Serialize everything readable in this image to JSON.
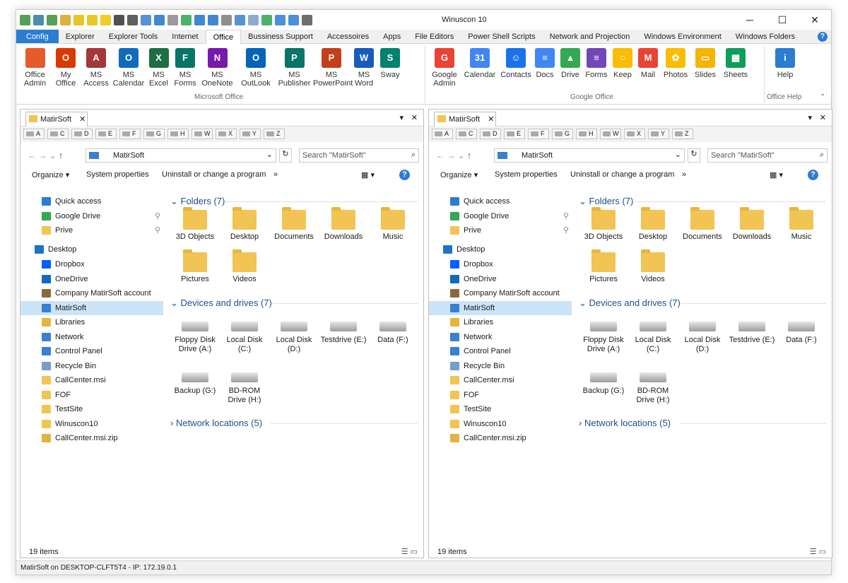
{
  "window": {
    "title": "Winuscon 10"
  },
  "tabs": [
    "Config",
    "Explorer",
    "Explorer Tools",
    "Internet",
    "Office",
    "Bussiness Support",
    "Accessoires",
    "Apps",
    "File Editors",
    "Power Shell Scripts",
    "Network and Projection",
    "Windows Environment",
    "Windows Folders"
  ],
  "help_glyph": "?",
  "ribbon": {
    "ms_items": [
      {
        "label": "Office Admin",
        "color": "#e65b2b",
        "glyph": ""
      },
      {
        "label": "My Office",
        "color": "#d83b01",
        "glyph": "O"
      },
      {
        "label": "MS Access",
        "color": "#a4373a",
        "glyph": "A"
      },
      {
        "label": "MS Calendar",
        "color": "#0f6cbd",
        "glyph": "O"
      },
      {
        "label": "MS Excel",
        "color": "#1d6f42",
        "glyph": "X"
      },
      {
        "label": "MS Forms",
        "color": "#077568",
        "glyph": "F"
      },
      {
        "label": "MS OneNote",
        "color": "#7719aa",
        "glyph": "N"
      },
      {
        "label": "MS OutLook",
        "color": "#0364b8",
        "glyph": "O"
      },
      {
        "label": "MS Publisher",
        "color": "#077568",
        "glyph": "P"
      },
      {
        "label": "MS PowerPoint",
        "color": "#c43e1c",
        "glyph": "P"
      },
      {
        "label": "MS Word",
        "color": "#185abd",
        "glyph": "W"
      },
      {
        "label": "Sway",
        "color": "#008272",
        "glyph": "S"
      }
    ],
    "google_items": [
      {
        "label": "Google Admin",
        "color": "#ea4335",
        "glyph": "G"
      },
      {
        "label": "Calendar",
        "color": "#4285f4",
        "glyph": "31"
      },
      {
        "label": "Contacts",
        "color": "#1a73e8",
        "glyph": "☺"
      },
      {
        "label": "Docs",
        "color": "#4285f4",
        "glyph": "≡"
      },
      {
        "label": "Drive",
        "color": "#34a853",
        "glyph": "▲"
      },
      {
        "label": "Forms",
        "color": "#7248b9",
        "glyph": "≡"
      },
      {
        "label": "Keep",
        "color": "#fbbc04",
        "glyph": "○"
      },
      {
        "label": "Mail",
        "color": "#ea4335",
        "glyph": "M"
      },
      {
        "label": "Photos",
        "color": "#fbbc04",
        "glyph": "✿"
      },
      {
        "label": "Slides",
        "color": "#f4b400",
        "glyph": "▭"
      },
      {
        "label": "Sheets",
        "color": "#0f9d58",
        "glyph": "▦"
      }
    ],
    "help_item": {
      "label": "Help",
      "color": "#2b7cd3",
      "glyph": "i"
    },
    "groups": [
      "Microsoft Office",
      "Google Office",
      "Office Help"
    ]
  },
  "pane": {
    "tab_label": "MatirSoft",
    "drives": [
      "A",
      "C",
      "D",
      "E",
      "F",
      "G",
      "H",
      "W",
      "X",
      "Y",
      "Z"
    ],
    "breadcrumb": "MatirSoft",
    "search_placeholder": "Search \"MatirSoft\"",
    "toolbar": [
      "Organize ▾",
      "System properties",
      "Uninstall or change a program",
      "»"
    ],
    "tree": [
      {
        "label": "Quick access",
        "color": "#2b7cd3"
      },
      {
        "label": "Google Drive",
        "color": "#34a853"
      },
      {
        "label": "Prive",
        "color": "#f1c453"
      },
      {
        "label": "Desktop",
        "color": "#1e73c8"
      },
      {
        "label": "Dropbox",
        "color": "#0061fe"
      },
      {
        "label": "OneDrive",
        "color": "#0f6cbd"
      },
      {
        "label": "Company MatirSoft account",
        "color": "#8a6a3c"
      },
      {
        "label": "MatirSoft",
        "color": "#3a7fd0"
      },
      {
        "label": "Libraries",
        "color": "#e6b53c"
      },
      {
        "label": "Network",
        "color": "#3a7fd0"
      },
      {
        "label": "Control Panel",
        "color": "#3a7fd0"
      },
      {
        "label": "Recycle Bin",
        "color": "#7a9cc6"
      },
      {
        "label": "CallCenter.msi",
        "color": "#f1c453"
      },
      {
        "label": "FOF",
        "color": "#f1c453"
      },
      {
        "label": "TestSite",
        "color": "#f1c453"
      },
      {
        "label": "Winuscon10",
        "color": "#f1c453"
      },
      {
        "label": "CallCenter.msi.zip",
        "color": "#e0b440"
      }
    ],
    "folders_header": "Folders (7)",
    "folders": [
      "3D Objects",
      "Desktop",
      "Documents",
      "Downloads",
      "Music",
      "Pictures",
      "Videos"
    ],
    "drives_header": "Devices and drives (7)",
    "devices": [
      "Floppy Disk Drive (A:)",
      "Local Disk (C:)",
      "Local Disk (D:)",
      "Testdrive (E:)",
      "Data (F:)",
      "Backup (G:)",
      "BD-ROM Drive (H:)"
    ],
    "network_header": "Network locations (5)",
    "items_count": "19 items"
  },
  "statusbar": "MatirSoft on DESKTOP-CLFT5T4 - IP: 172.19.0.1"
}
